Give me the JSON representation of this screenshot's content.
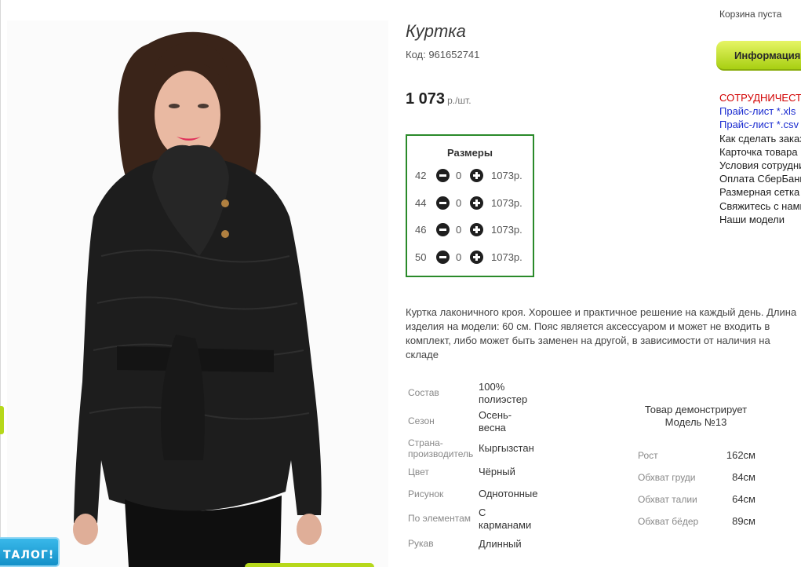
{
  "product": {
    "title": "Куртка",
    "sku": "Код: 961652741",
    "price": "1 073",
    "price_unit": "р./шт.",
    "description": "Куртка лаконичного кроя. Хорошее и практичное решение на каждый день. Длина изделия на модели: 60 см. Пояс является аксессуаром и может не входить в комплект, либо может быть заменен на другой, в зависимости от наличия на складе"
  },
  "sizes": {
    "title": "Размеры",
    "rows": [
      {
        "size": "42",
        "qty": "0",
        "price": "1073р."
      },
      {
        "size": "44",
        "qty": "0",
        "price": "1073р."
      },
      {
        "size": "46",
        "qty": "0",
        "price": "1073р."
      },
      {
        "size": "50",
        "qty": "0",
        "price": "1073р."
      }
    ]
  },
  "attributes": [
    {
      "label": "Состав",
      "value": "100% полиэстер"
    },
    {
      "label": "Сезон",
      "value": "Осень-весна"
    },
    {
      "label": "Страна-производитель",
      "value": "Кыргызстан"
    },
    {
      "label": "Цвет",
      "value": "Чёрный"
    },
    {
      "label": "Рисунок",
      "value": "Однотонные"
    },
    {
      "label": "По элементам",
      "value": "С карманами"
    },
    {
      "label": "Рукав",
      "value": "Длинный"
    }
  ],
  "model": {
    "title": "Товар демонстрирует Модель №13",
    "params": [
      {
        "label": "Рост",
        "value": "162см"
      },
      {
        "label": "Обхват груди",
        "value": "84см"
      },
      {
        "label": "Обхват талии",
        "value": "64см"
      },
      {
        "label": "Обхват бёдер",
        "value": "89см"
      }
    ]
  },
  "sidebar": {
    "cart": "Корзина пуста",
    "info_button": "Информация",
    "links": [
      {
        "label": "СОТРУДНИЧЕСТВО",
        "style": "red"
      },
      {
        "label": "Прайс-лист *.xls",
        "style": "blue"
      },
      {
        "label": "Прайс-лист *.csv",
        "style": "blue"
      },
      {
        "label": "Как сделать заказ",
        "style": "dark"
      },
      {
        "label": "Карточка товара",
        "style": "dark"
      },
      {
        "label": "Условия сотрудничества",
        "style": "dark"
      },
      {
        "label": "Оплата СберБанк",
        "style": "dark"
      },
      {
        "label": "Размерная сетка",
        "style": "dark"
      },
      {
        "label": "Свяжитесь с нами",
        "style": "dark"
      },
      {
        "label": "Наши модели",
        "style": "dark"
      }
    ]
  },
  "catalog_badge": "ТАЛОГ!",
  "colors": {
    "accent_green": "#b6d81b",
    "sizes_border": "#2a8a2a",
    "catalog_blue": "#1fa3dc"
  }
}
